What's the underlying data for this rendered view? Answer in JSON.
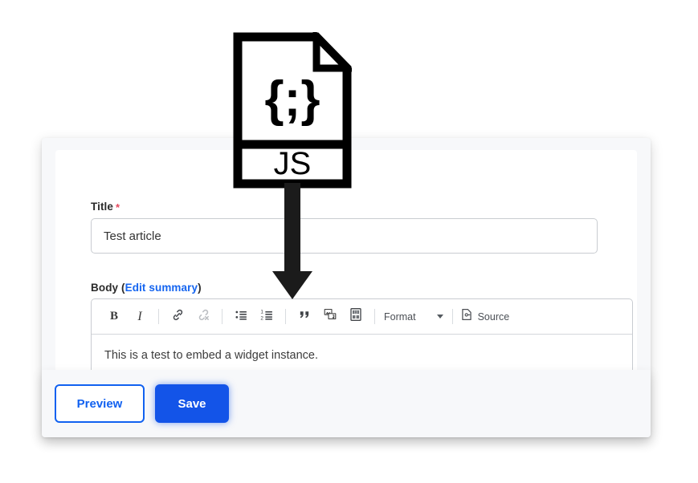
{
  "form": {
    "title_field": {
      "label": "Title",
      "required_marker": "*",
      "value": "Test article",
      "placeholder": "Title"
    },
    "body_field": {
      "label": "Body",
      "open_paren": "(",
      "link_label": "Edit summary",
      "close_paren": ")",
      "content": "This is a test to embed a widget instance."
    }
  },
  "toolbar": {
    "bold_label": "B",
    "italic_label": "I",
    "link_name": "link-icon",
    "unlink_name": "unlink-icon",
    "bulleted_list_name": "bulleted-list-icon",
    "numbered_list_name": "numbered-list-icon",
    "blockquote_label": "”",
    "media_name": "media-icon",
    "widget_name": "widget-embed-icon",
    "format_label": "Format",
    "source_label": "Source"
  },
  "actions": {
    "preview_label": "Preview",
    "save_label": "Save"
  },
  "annotation": {
    "file_icon": {
      "code_glyph": "{ ; }",
      "extension_label": "JS"
    },
    "arrow_name": "down-arrow-annotation"
  },
  "colors": {
    "primary": "#1354e8",
    "link": "#1565f0",
    "required": "#e4485d",
    "panel_bg": "#f7f8fa",
    "border": "#c9ccd1"
  }
}
